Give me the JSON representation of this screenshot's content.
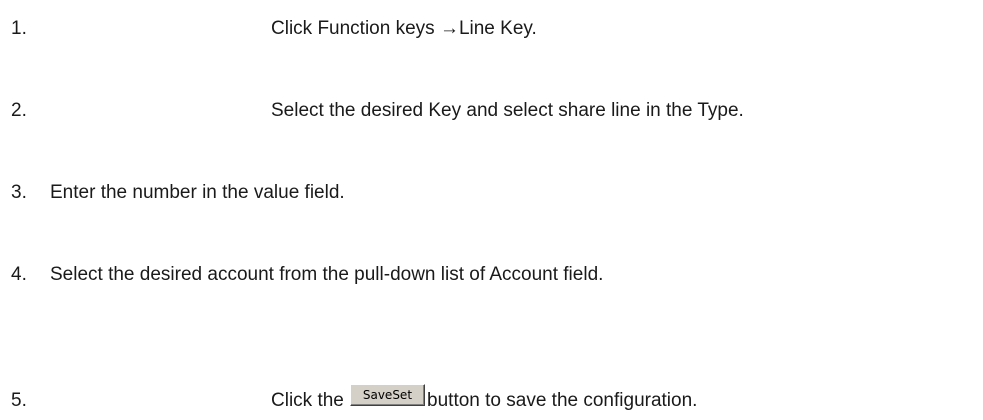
{
  "steps": [
    {
      "number": "1.",
      "text": "Click Function keys →Line Key."
    },
    {
      "number": "2.",
      "text": "Select the desired Key and select share line in the Type."
    },
    {
      "number": "3.",
      "text": "Enter the number in the value field."
    },
    {
      "number": "4.",
      "text": "Select the desired account from the pull-down list of Account field."
    },
    {
      "number": "5.",
      "text_before": "Click the",
      "button_label": "SaveSet",
      "text_after": "button to save the configuration."
    }
  ]
}
